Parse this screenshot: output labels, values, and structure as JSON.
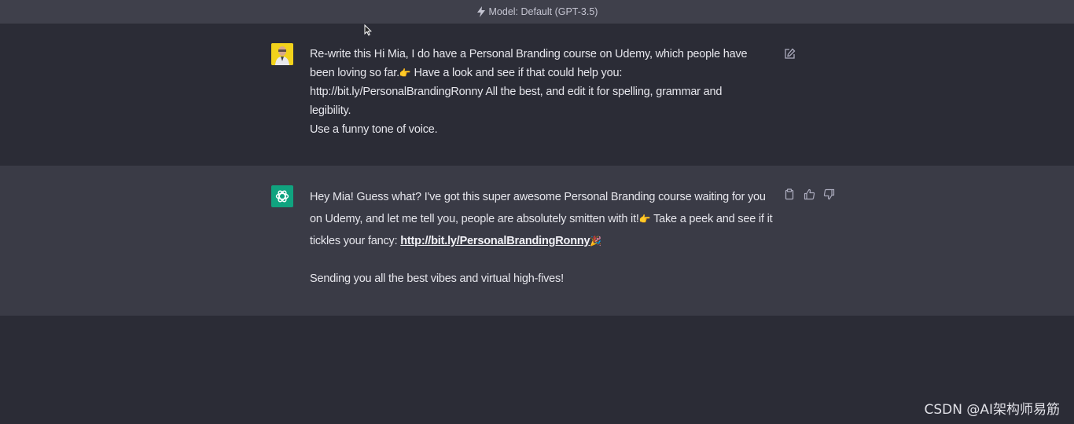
{
  "header": {
    "model_label": "Model: Default (GPT-3.5)"
  },
  "user_message": {
    "line1": "Re-write this Hi Mia,   I do have a Personal Branding course on Udemy, which people have",
    "line2_start": "been loving so far.",
    "line2_end": " Have a look and see if that could help you:",
    "line3": "http://bit.ly/PersonalBrandingRonny  All the best,  and edit it for spelling, grammar and",
    "line4": "legibility.",
    "line5": "Use a funny tone of voice."
  },
  "assistant_message": {
    "text_part1": "Hey Mia! Guess what? I've got this super awesome Personal Branding course waiting for you on Udemy, and let me tell you, people are absolutely smitten with it!",
    "text_part2": " Take a peek and see if it tickles your fancy: ",
    "link": "http://bit.ly/PersonalBrandingRonny",
    "paragraph2": "Sending you all the best vibes and virtual high-fives!"
  },
  "icons": {
    "pointing_emoji": "👉",
    "party_emoji": "🎉"
  },
  "watermark": "CSDN @AI架构师易筋",
  "colors": {
    "background": "#343541",
    "user_bg": "#2b2c36",
    "assistant_bg": "#3a3b46",
    "accent": "#10a37f",
    "user_avatar": "#f2d21b"
  }
}
